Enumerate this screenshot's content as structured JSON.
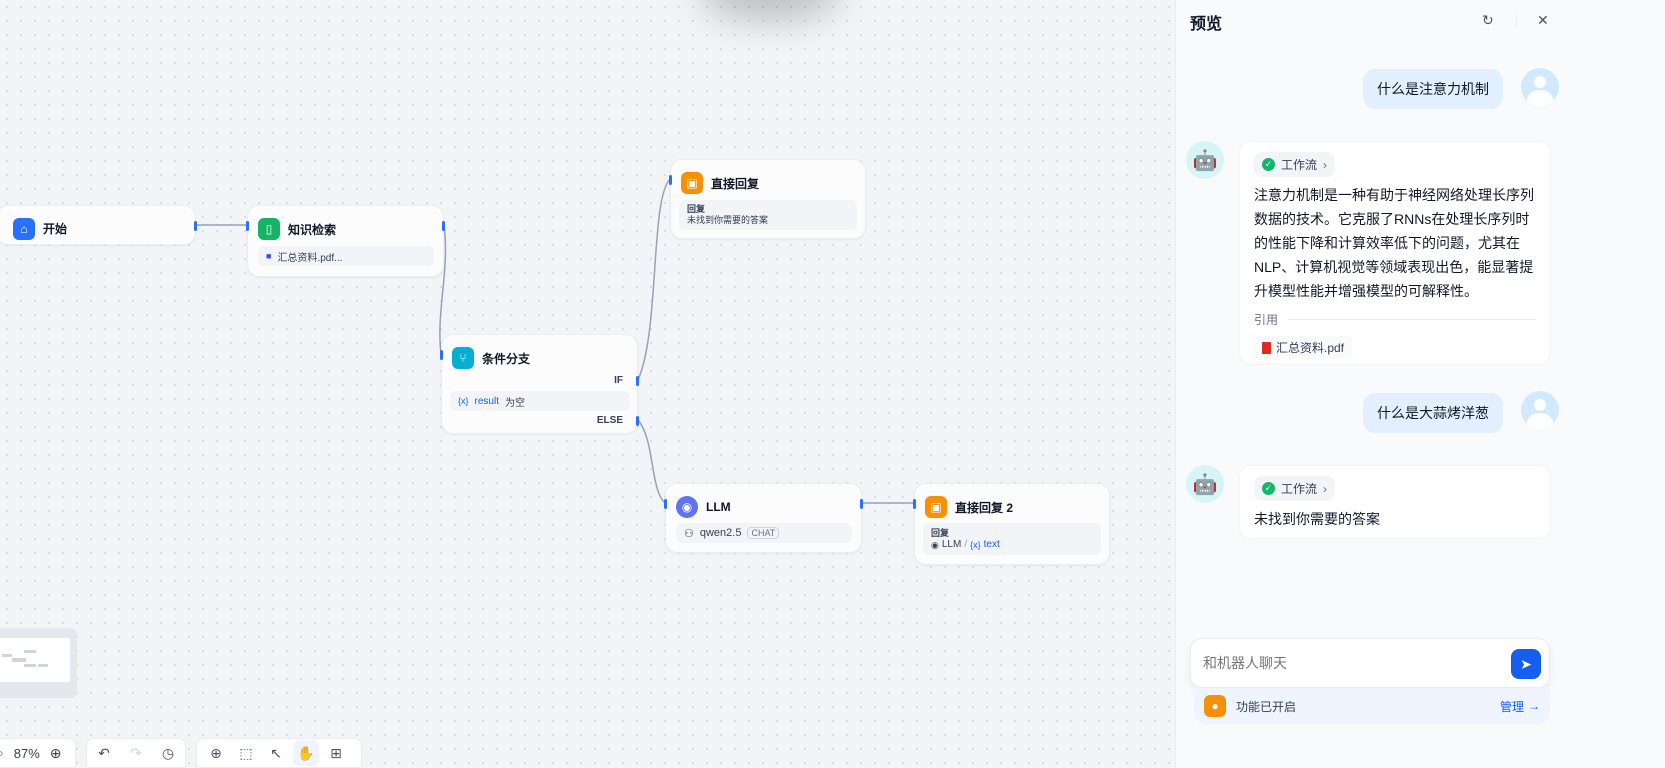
{
  "canvas": {
    "nodes": {
      "start": {
        "title": "开始"
      },
      "knowledge": {
        "title": "知识检索",
        "file": "汇总资料.pdf..."
      },
      "direct_reply_1": {
        "title": "直接回复",
        "label": "回复",
        "text": "未找到你需要的答案"
      },
      "condition": {
        "title": "条件分支",
        "if_label": "IF",
        "else_label": "ELSE",
        "var_prefix": "{x}",
        "var_name": "result",
        "op": "为空"
      },
      "llm": {
        "title": "LLM",
        "model": "qwen2.5",
        "badge": "CHAT"
      },
      "direct_reply_2": {
        "title": "直接回复 2",
        "label": "回复",
        "src_node": "LLM",
        "sep": "/",
        "var_prefix": "{x}",
        "var_name": "text"
      }
    },
    "toolbar": {
      "zoom": "87%"
    }
  },
  "panel": {
    "title": "预览",
    "messages": [
      {
        "role": "user",
        "text": "什么是注意力机制"
      },
      {
        "role": "bot",
        "workflow_label": "工作流",
        "text": "注意力机制是一种有助于神经网络处理长序列数据的技术。它克服了RNNs在处理长序列时的性能下降和计算效率低下的问题，尤其在NLP、计算机视觉等领域表现出色，能显著提升模型性能并增强模型的可解释性。",
        "cite_label": "引用",
        "cite_file": "汇总资料.pdf"
      },
      {
        "role": "user",
        "text": "什么是大蒜烤洋葱"
      },
      {
        "role": "bot",
        "workflow_label": "工作流",
        "text": "未找到你需要的答案"
      }
    ],
    "input_placeholder": "和机器人聊天",
    "feature_status": "功能已开启",
    "manage_label": "管理"
  },
  "colors": {
    "accent": "#155eef",
    "start": "#2970ff",
    "knowledge": "#16b364",
    "reply": "#f79009",
    "condition": "#06aed4",
    "llm": "#6172f3"
  }
}
